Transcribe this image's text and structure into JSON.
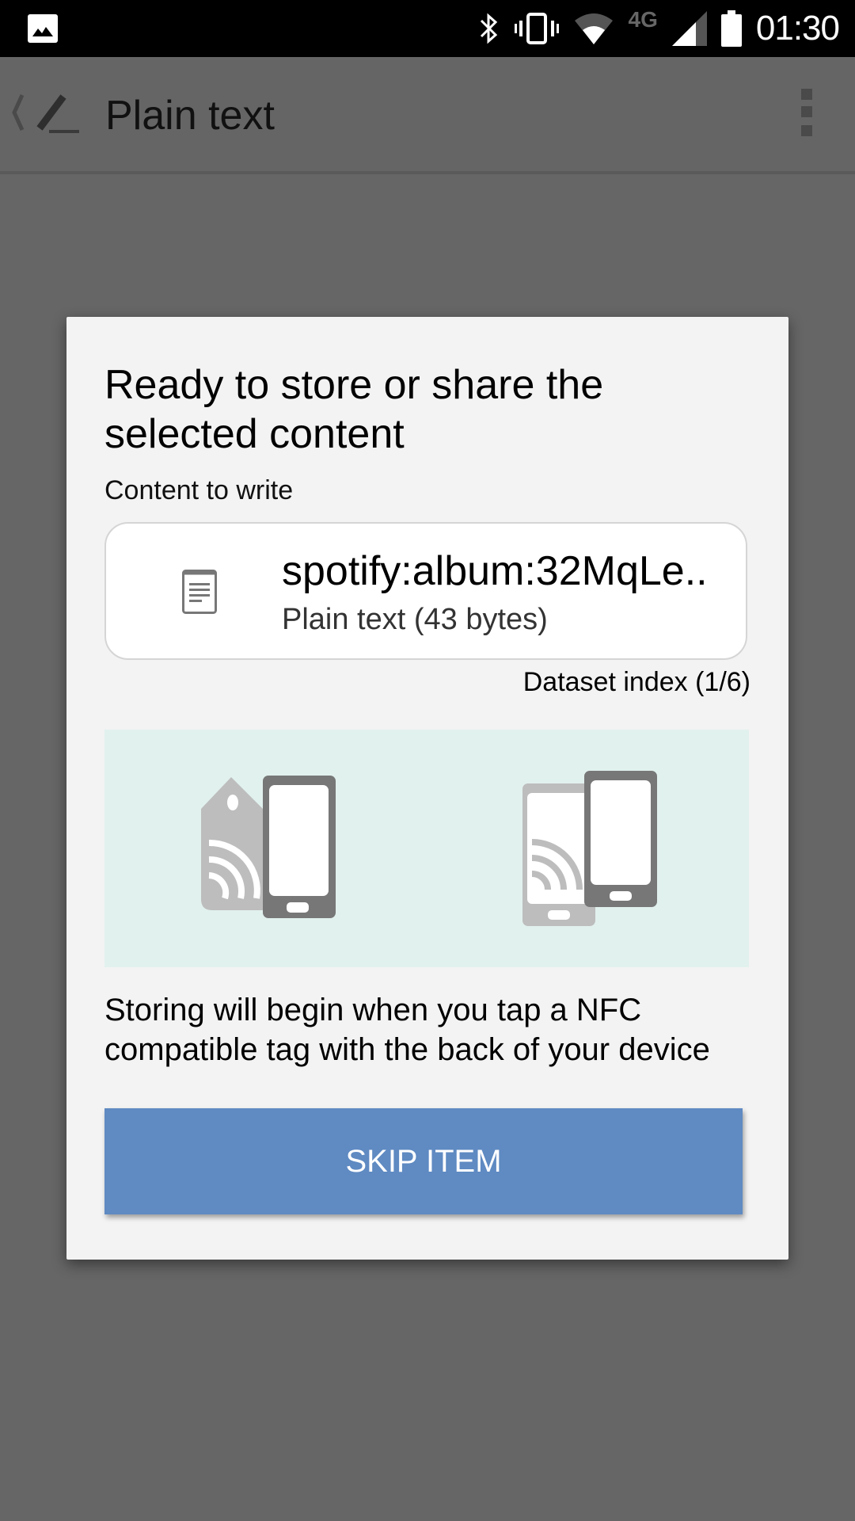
{
  "status_bar": {
    "time": "01:30",
    "network_type": "4G",
    "icons": [
      "gallery-notification-icon",
      "bluetooth-icon",
      "vibrate-icon",
      "wifi-icon",
      "cell-signal-icon",
      "battery-icon"
    ]
  },
  "app_bar": {
    "title": "Plain text",
    "icons": [
      "back-chevron-icon",
      "edit-pencil-icon",
      "more-vert-icon"
    ]
  },
  "dialog": {
    "title": "Ready to store or share the selected content",
    "content_label": "Content to write",
    "content_item": {
      "icon": "document-icon",
      "value": "spotify:album:32MqLe..",
      "type_label": "Plain text (43 bytes)"
    },
    "dataset_index": "Dataset index (1/6)",
    "illustrations": [
      "nfc-tag-to-phone-icon",
      "phone-to-phone-icon"
    ],
    "instruction": "Storing will begin when you tap a NFC compatible tag with the back of your device",
    "skip_button_label": "SKIP ITEM",
    "colors": {
      "button": "#5f8ac2",
      "illustration_bg": "#e1f1ee"
    }
  }
}
